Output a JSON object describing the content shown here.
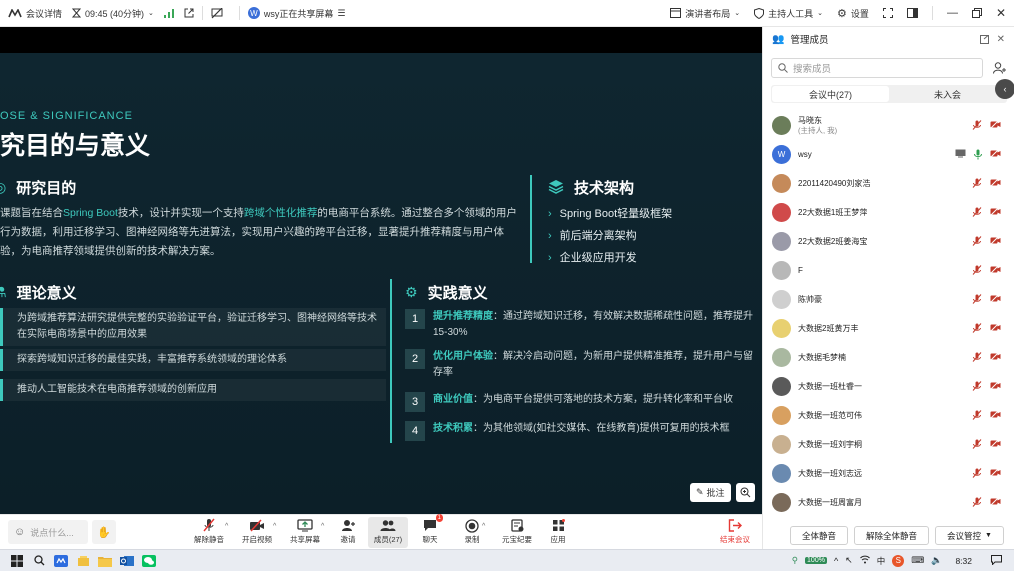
{
  "topbar": {
    "meeting_details": "会议详情",
    "time": "09:45 (40分钟)",
    "sharing_user_initial": "W",
    "sharing_text": "wsy正在共享屏幕",
    "speaker_layout": "演讲者布局",
    "host_tools": "主持人工具",
    "settings": "设置"
  },
  "slide": {
    "kicker": "OSE & SIGNIFICANCE",
    "title": "究目的与意义",
    "purpose": {
      "heading": "研究目的",
      "para_pre": "课题旨在结合",
      "para_hl1": "Spring Boot",
      "para_mid1": "技术，设计并实现一个支持",
      "para_hl2": "跨域个性化推荐",
      "para_rest": "的电商平台系统。通过整合多个领域的用户行为数据，利用迁移学习、图神经网络等先进算法，实现用户兴趣的跨平台迁移，显著提升推荐精度与用户体验，为电商推荐领域提供创新的技术解决方案。"
    },
    "tech": {
      "heading": "技术架构",
      "items": [
        "Spring Boot轻量级框架",
        "前后端分离架构",
        "企业级应用开发"
      ]
    },
    "theory": {
      "heading": "理论意义",
      "items": [
        "为跨域推荐算法研究提供完整的实验验证平台，验证迁移学习、图神经网络等技术在实际电商场景中的应用效果",
        "探索跨域知识迁移的最佳实践，丰富推荐系统领域的理论体系",
        "推动人工智能技术在电商推荐领域的创新应用"
      ]
    },
    "practice": {
      "heading": "实践意义",
      "items": [
        {
          "num": "1",
          "label": "提升推荐精度",
          "text": "：通过跨域知识迁移，有效解决数据稀疏性问题，推荐提升15-30%"
        },
        {
          "num": "2",
          "label": "优化用户体验",
          "text": "：解决冷启动问题，为新用户提供精准推荐，提升用户与留存率"
        },
        {
          "num": "3",
          "label": "商业价值",
          "text": "：为电商平台提供可落地的技术方案，提升转化率和平台收"
        },
        {
          "num": "4",
          "label": "技术积累",
          "text": "：为其他领域(如社交媒体、在线教育)提供可复用的技术框"
        }
      ]
    },
    "annotate_label": "批注"
  },
  "toolbar": {
    "chat_placeholder": "说点什么...",
    "unmute": "解除静音",
    "start_video": "开启视频",
    "share_screen": "共享屏幕",
    "invite": "邀请",
    "members": "成员(27)",
    "chat": "聊天",
    "chat_badge": "1",
    "record": "录制",
    "ai_minutes": "元宝纪要",
    "apps": "应用",
    "end_meeting": "结束会议"
  },
  "panel": {
    "title": "管理成员",
    "search_placeholder": "搜索成员",
    "tab_in_meeting": "会议中(27)",
    "tab_not_joined": "未入会",
    "members": [
      {
        "name": "马晓东",
        "sub": "(主持人, 我)",
        "color": "#6b7d5a"
      },
      {
        "name": "wsy",
        "sub": "",
        "color": "#3b6fd8",
        "initial": "W"
      },
      {
        "name": "22011420490刘家浩",
        "sub": "",
        "color": "#c58a5a"
      },
      {
        "name": "22大数据1班王梦萍",
        "sub": "",
        "color": "#d04a4a"
      },
      {
        "name": "22大数据2班姜海宝",
        "sub": "",
        "color": "#9a9aa8"
      },
      {
        "name": "F",
        "sub": "",
        "color": "#b8b8b8"
      },
      {
        "name": "陈帅豪",
        "sub": "",
        "color": "#cfcfcf"
      },
      {
        "name": "大数据2班黄万丰",
        "sub": "",
        "color": "#e8d070"
      },
      {
        "name": "大数据毛梦楠",
        "sub": "",
        "color": "#a9b8a0"
      },
      {
        "name": "大数据一班杜睿一",
        "sub": "",
        "color": "#5a5a5a"
      },
      {
        "name": "大数据一班范可伟",
        "sub": "",
        "color": "#d8a060"
      },
      {
        "name": "大数据一班刘宇桐",
        "sub": "",
        "color": "#c8b090"
      },
      {
        "name": "大数据一班刘志远",
        "sub": "",
        "color": "#6a8ab0"
      },
      {
        "name": "大数据一班周富月",
        "sub": "",
        "color": "#7a6a5a"
      }
    ],
    "mute_all": "全体静音",
    "unmute_all": "解除全体静音",
    "meeting_control": "会议管控"
  },
  "taskbar": {
    "battery": "100%",
    "ime": "中",
    "clock": "8:32"
  },
  "colors": {
    "accent": "#3ec9bd",
    "slide_bg": "#0f2630",
    "danger": "#e53935"
  }
}
